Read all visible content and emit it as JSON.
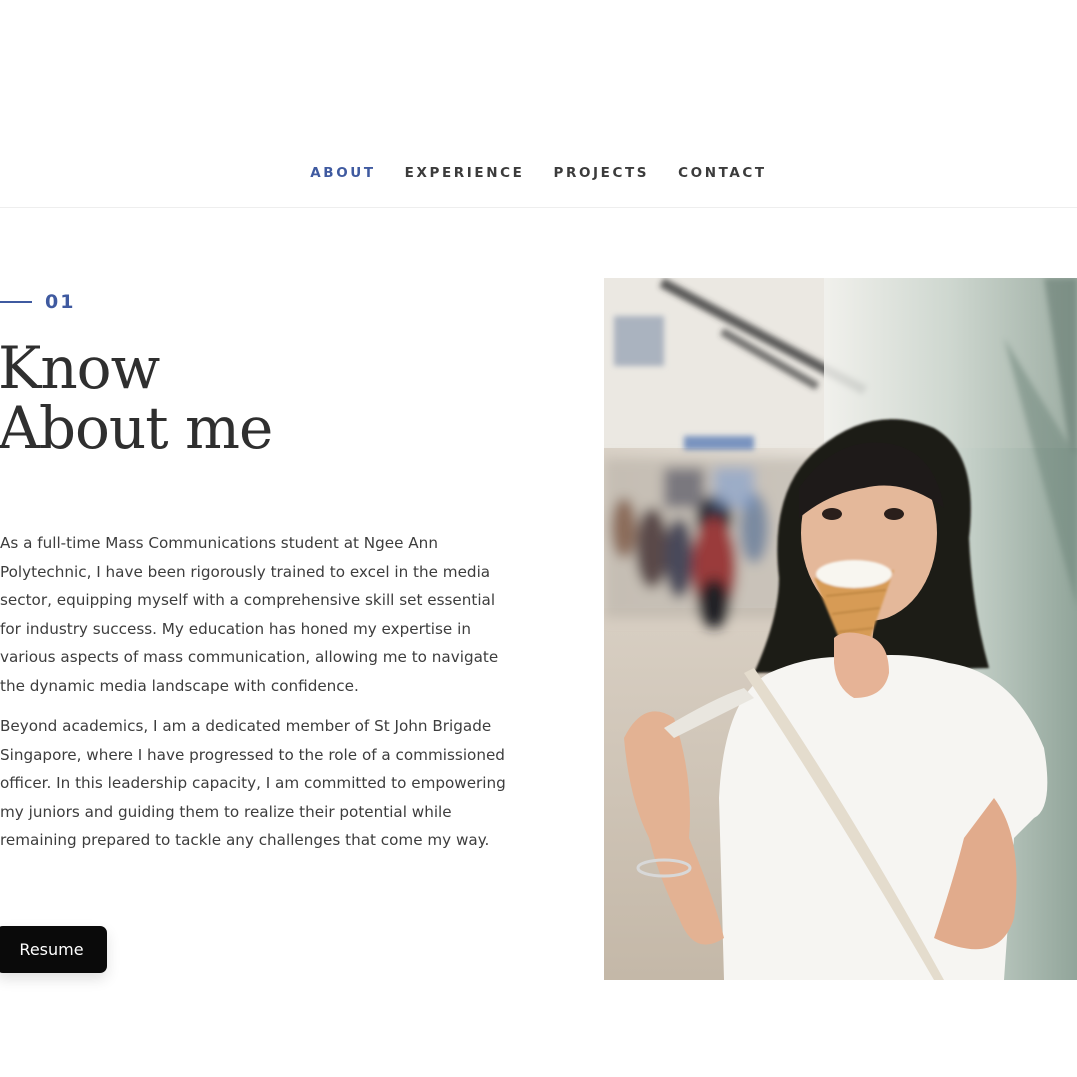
{
  "nav": {
    "items": [
      {
        "label": "ABOUT",
        "active": true
      },
      {
        "label": "EXPERIENCE",
        "active": false
      },
      {
        "label": "PROJECTS",
        "active": false
      },
      {
        "label": "CONTACT",
        "active": false
      }
    ]
  },
  "about": {
    "section_number": "01",
    "heading_line1": "Know",
    "heading_line2": "About me",
    "paragraph1": "As a full-time Mass Communications student at Ngee Ann Polytechnic, I have been rigorously trained to excel in the media sector, equipping myself with a comprehensive skill set essential for industry success. My education has honed my expertise in various aspects of mass communication, allowing me to navigate the dynamic media landscape with confidence.",
    "paragraph2": "Beyond academics, I am a dedicated member of St John Brigade Singapore, where I have progressed to the role of a commissioned officer. In this leadership capacity, I am committed to empowering my juniors and guiding them to realize their potential while remaining prepared to tackle any challenges that come my way.",
    "resume_label": "Resume"
  },
  "colors": {
    "accent": "#3f5aa0",
    "text": "#3d3d3d",
    "button_bg": "#0a0a0a"
  }
}
